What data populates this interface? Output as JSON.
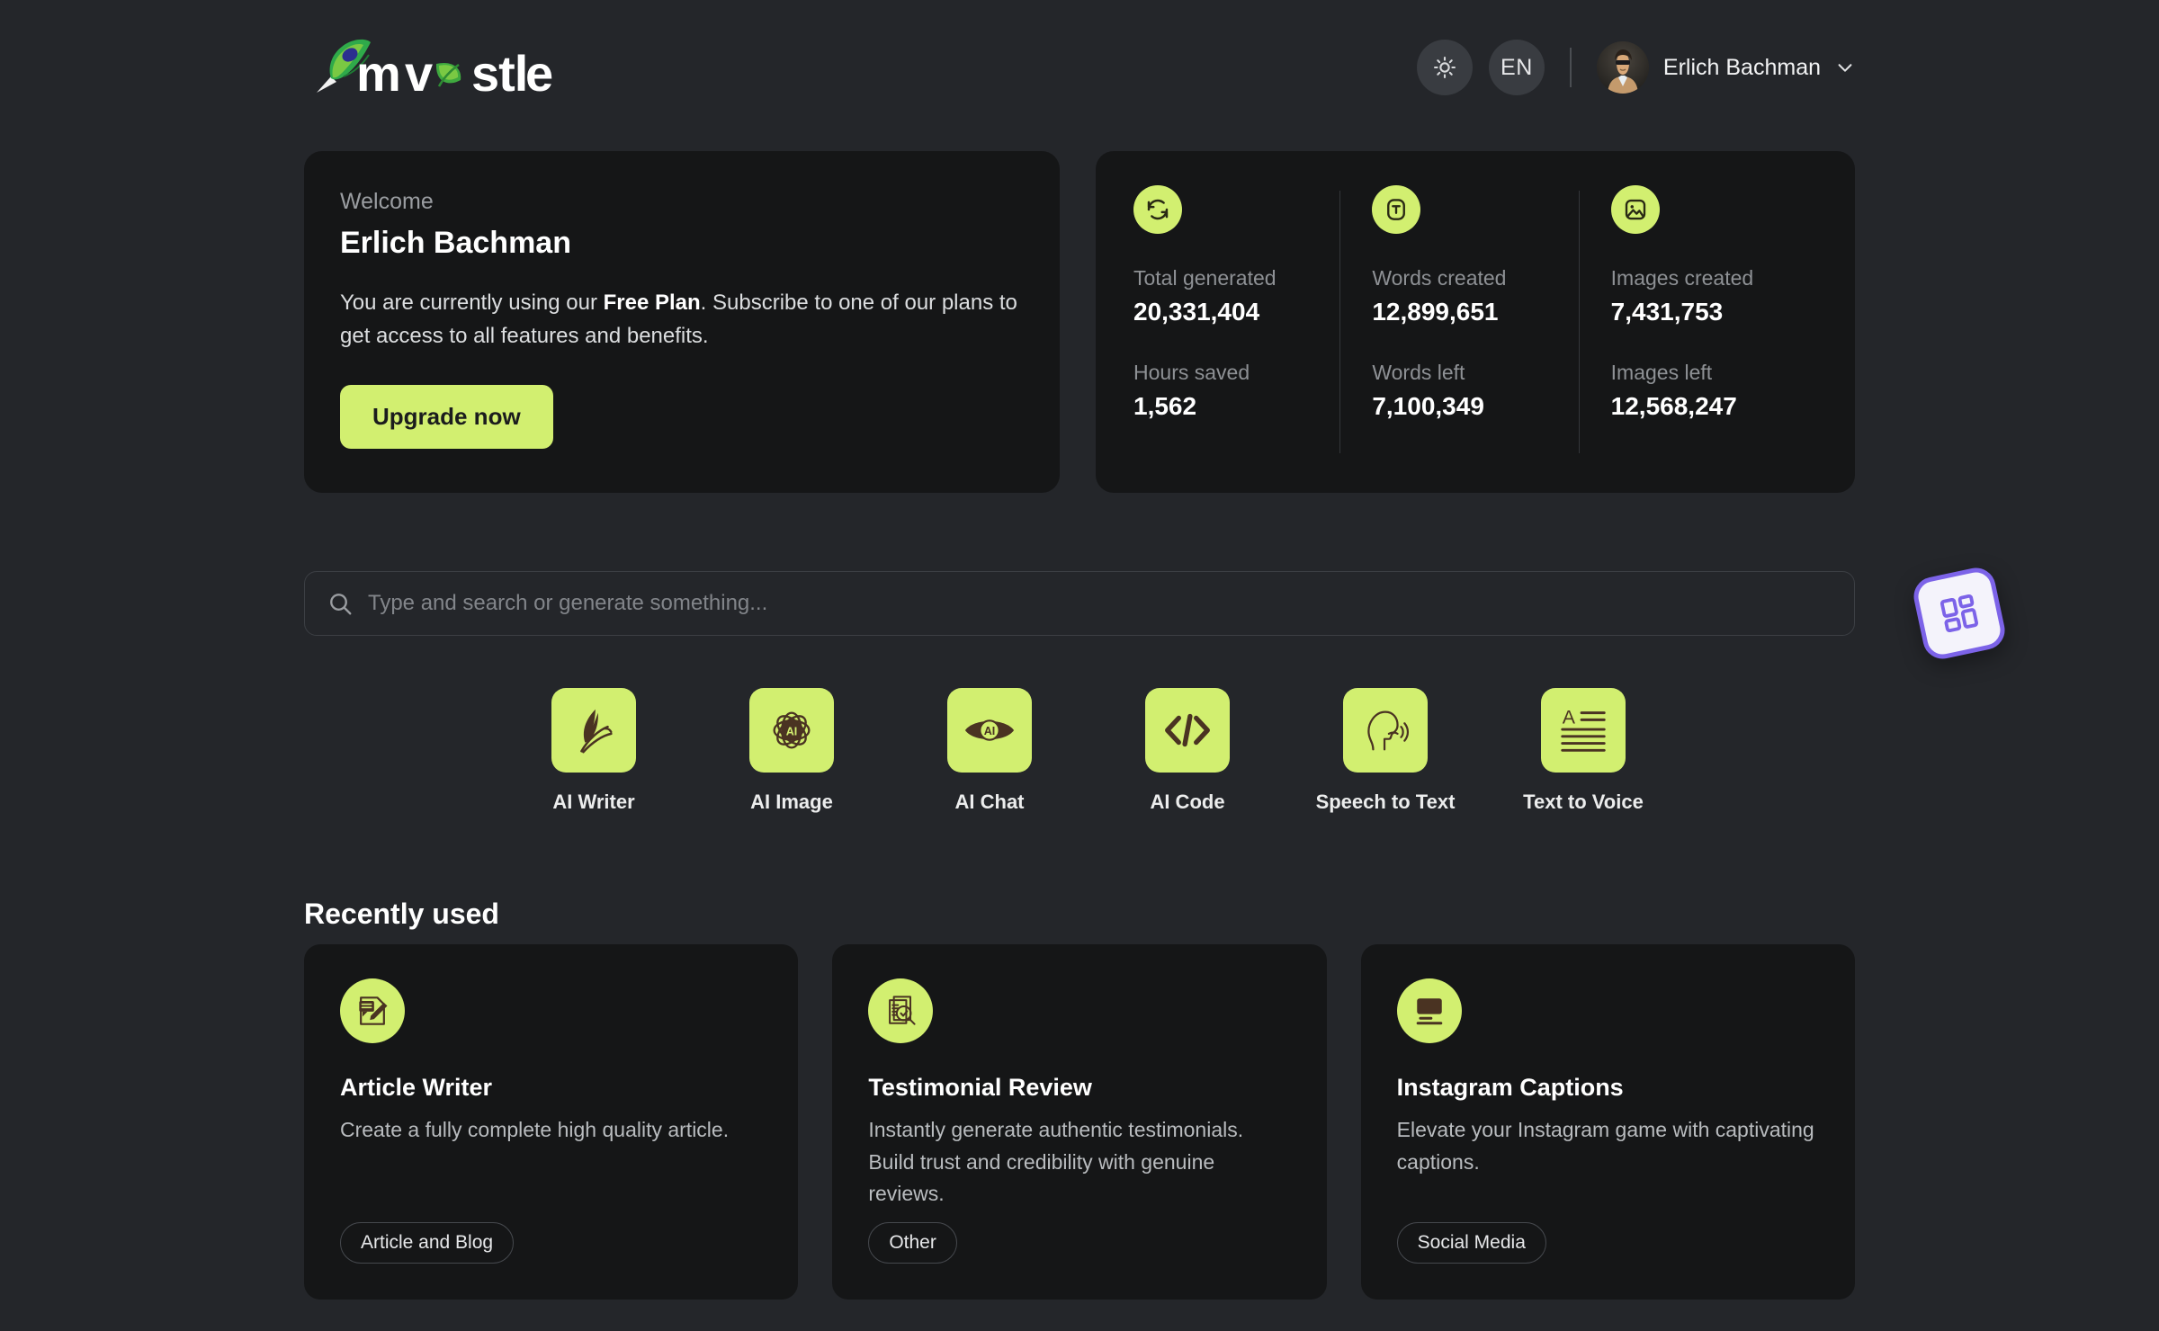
{
  "brand": {
    "name": "mvostle",
    "logo_icon": "feather-quill-logo"
  },
  "header": {
    "theme_toggle_icon": "sun-icon",
    "language_label": "EN",
    "user_name": "Erlich Bachman",
    "chevron_icon": "chevron-down-icon",
    "avatar_icon": "user-avatar-photo"
  },
  "welcome": {
    "label": "Welcome",
    "name": "Erlich Bachman",
    "desc_before": "You are currently using our ",
    "desc_plan": "Free Plan",
    "desc_after": ". Subscribe to one of our plans to get access to all features and benefits.",
    "upgrade_label": "Upgrade now"
  },
  "stats": [
    {
      "icon": "sync-refresh-icon",
      "label": "Total generated",
      "value": "20,331,404",
      "sub_label": "Hours saved",
      "sub_value": "1,562"
    },
    {
      "icon": "text-box-icon",
      "label": "Words created",
      "value": "12,899,651",
      "sub_label": "Words left",
      "sub_value": "7,100,349"
    },
    {
      "icon": "image-icon",
      "label": "Images created",
      "value": "7,431,753",
      "sub_label": "Images left",
      "sub_value": "12,568,247"
    }
  ],
  "search": {
    "icon": "search-icon",
    "placeholder": "Type and search or generate something...",
    "value": ""
  },
  "tools": [
    {
      "label": "AI Writer",
      "icon": "feather-pen-icon"
    },
    {
      "label": "AI Image",
      "icon": "ai-atom-icon"
    },
    {
      "label": "AI Chat",
      "icon": "ai-eye-icon"
    },
    {
      "label": "AI Code",
      "icon": "code-brackets-icon"
    },
    {
      "label": "Speech to Text",
      "icon": "speaking-head-icon"
    },
    {
      "label": "Text to Voice",
      "icon": "text-lines-icon"
    }
  ],
  "recent": {
    "title": "Recently used",
    "cards": [
      {
        "icon": "document-pencil-icon",
        "title": "Article Writer",
        "desc": "Create a fully complete high quality article.",
        "tag": "Article and Blog"
      },
      {
        "icon": "document-check-magnifier-icon",
        "title": "Testimonial Review",
        "desc": "Instantly generate authentic testimonials. Build trust and credibility with genuine reviews.",
        "tag": "Other"
      },
      {
        "icon": "monitor-caption-icon",
        "title": "Instagram Captions",
        "desc": "Elevate your Instagram game with captivating captions.",
        "tag": "Social Media"
      }
    ]
  },
  "floating_widget": {
    "icon": "grid-apps-icon"
  },
  "colors": {
    "page_bg": "#24262a",
    "card_bg": "#151617",
    "accent_lime": "#d2ef70",
    "icon_brown": "#4a3322",
    "widget_purple": "#7c63e8"
  }
}
